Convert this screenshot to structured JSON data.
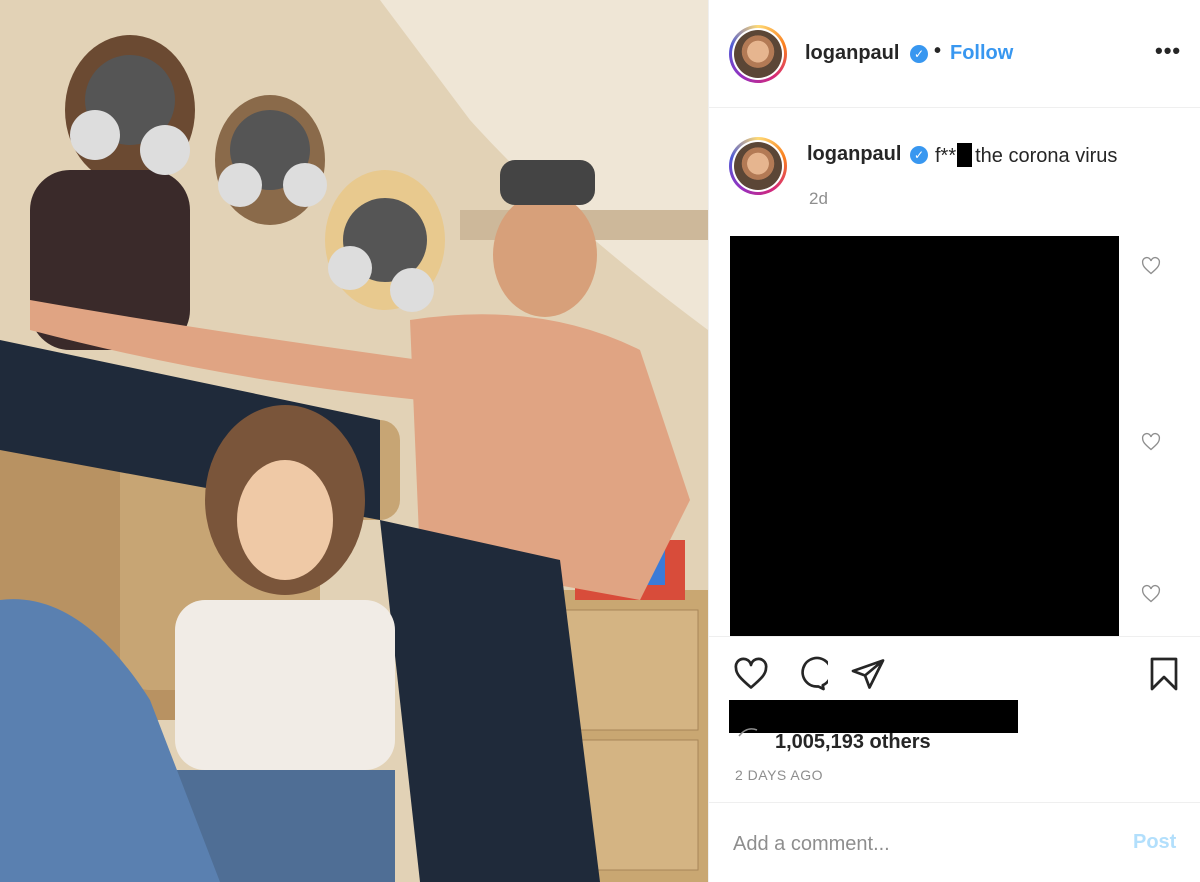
{
  "post": {
    "author": "loganpaul",
    "verified_mark": "✓",
    "separator": "•",
    "follow_label": "Follow",
    "more_label": "•••",
    "caption_prefix": "f**",
    "caption_suffix": "the corona virus",
    "caption_time": "2d",
    "likes_text": "1,005,193 others",
    "date": "2 DAYS AGO",
    "comment_placeholder": "Add a comment...",
    "post_label": "Post"
  },
  "icons": {
    "like": "heart-icon",
    "comment": "comment-bubble-icon",
    "share": "paper-plane-icon",
    "save": "bookmark-icon",
    "more": "more-options-icon",
    "verified": "verified-badge-icon"
  },
  "colors": {
    "accent": "#3897f0",
    "post_disabled": "#b2dffc",
    "muted": "#8e8e8e",
    "text": "#262626"
  }
}
